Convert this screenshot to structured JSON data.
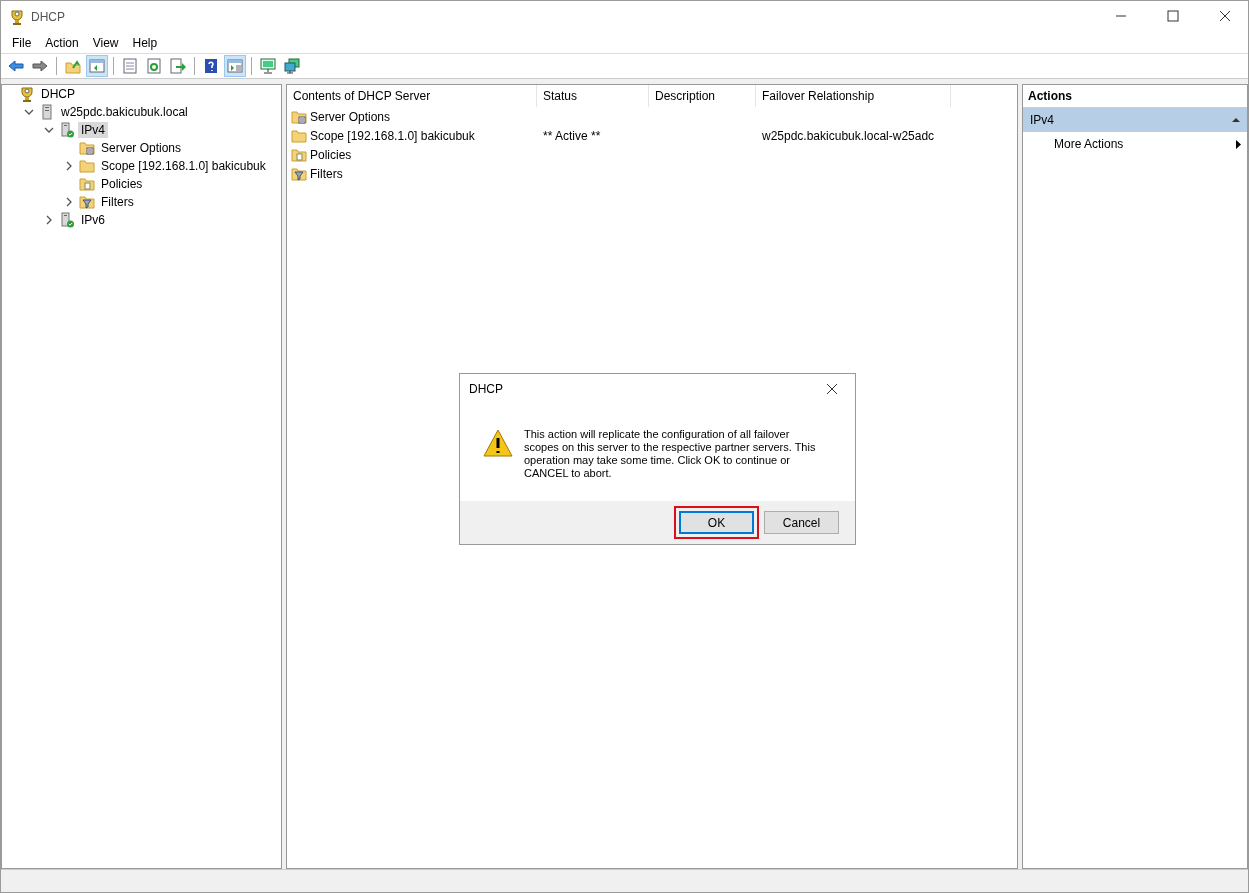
{
  "window": {
    "title": "DHCP"
  },
  "menu": [
    "File",
    "Action",
    "View",
    "Help"
  ],
  "toolbar": [
    {
      "kind": "back",
      "pressed": false
    },
    {
      "kind": "forward",
      "pressed": false
    },
    {
      "kind": "sep"
    },
    {
      "kind": "up",
      "pressed": false
    },
    {
      "kind": "tree",
      "pressed": true
    },
    {
      "kind": "sep"
    },
    {
      "kind": "properties",
      "pressed": false
    },
    {
      "kind": "refresh",
      "pressed": false
    },
    {
      "kind": "export",
      "pressed": false
    },
    {
      "kind": "sep"
    },
    {
      "kind": "help",
      "pressed": false
    },
    {
      "kind": "actionpane",
      "pressed": true
    },
    {
      "kind": "sep"
    },
    {
      "kind": "monitor",
      "pressed": false
    },
    {
      "kind": "monitors",
      "pressed": false
    }
  ],
  "tree": [
    {
      "label": "DHCP",
      "kind": "dhcp",
      "selected": false,
      "children": [
        {
          "label": "w25pdc.bakicubuk.local",
          "kind": "server",
          "selected": false,
          "expanded": true,
          "children": [
            {
              "label": "IPv4",
              "kind": "ipserver",
              "selected": true,
              "expanded": true,
              "children": [
                {
                  "label": "Server Options",
                  "kind": "options",
                  "selected": false
                },
                {
                  "label": "Scope [192.168.1.0] bakicubuk",
                  "kind": "folder",
                  "selected": false,
                  "expanded": false
                },
                {
                  "label": "Policies",
                  "kind": "policies",
                  "selected": false
                },
                {
                  "label": "Filters",
                  "kind": "filters",
                  "selected": false,
                  "expanded": false
                }
              ]
            },
            {
              "label": "IPv6",
              "kind": "ipserver",
              "selected": false,
              "expanded": false
            }
          ]
        }
      ]
    }
  ],
  "table": {
    "columns": [
      "Contents of DHCP Server",
      "Status",
      "Description",
      "Failover Relationship"
    ],
    "rows": [
      {
        "kind": "options",
        "cells": [
          "Server Options",
          "",
          "",
          ""
        ]
      },
      {
        "kind": "folder",
        "cells": [
          "Scope [192.168.1.0] bakicubuk",
          "** Active **",
          "",
          "w25pdc.bakicubuk.local-w25adc"
        ]
      },
      {
        "kind": "policies",
        "cells": [
          "Policies",
          "",
          "",
          ""
        ]
      },
      {
        "kind": "filters",
        "cells": [
          "Filters",
          "",
          "",
          ""
        ]
      }
    ]
  },
  "actions": {
    "title": "Actions",
    "section": "IPv4",
    "items": [
      "More Actions"
    ]
  },
  "dialog": {
    "title": "DHCP",
    "message": "This action will replicate the configuration of all failover scopes on this server to the respective partner servers. This operation may take some time. Click OK to continue or CANCEL to abort.",
    "buttons": [
      {
        "label": "OK",
        "default": true,
        "highlighted": true
      },
      {
        "label": "Cancel",
        "default": false,
        "highlighted": false
      }
    ]
  }
}
